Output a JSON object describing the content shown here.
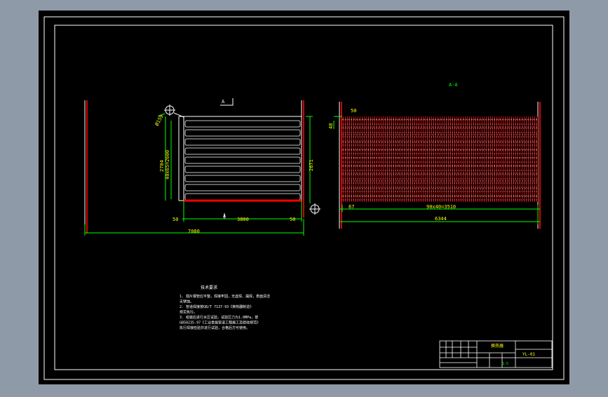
{
  "viewport": {
    "background": "#8e9aa8",
    "paper": "#000000"
  },
  "colors": {
    "white": "#ffffff",
    "yellow": "#ffff00",
    "green": "#00ff00",
    "red": "#ff0000",
    "dim": "#9a9a9a",
    "tube_red": "#c80000"
  },
  "left_view": {
    "section_marker": "A",
    "section_marker_bottom": "A",
    "dims": {
      "overall_width": "7080",
      "mid_width": "3800",
      "left_offset": "50",
      "right_offset": "50",
      "height_outer": "2704",
      "height_inner": "40x65=2600",
      "right_height": "2671",
      "pipe_dia": "Ø159"
    }
  },
  "right_view": {
    "section_title": "A-A",
    "dims": {
      "top_offset": "50",
      "left_offset": "48",
      "fin_pitch": "90x40=3510",
      "left_margin": "67",
      "overall_width": "6344"
    }
  },
  "notes": {
    "title": "技术要求",
    "lines": [
      "1. 翅片钢管应平整，焊接牢固，无虚焊、漏焊，表面清洁",
      "   无锈蚀。",
      "2. 管道焊接按GB/T 7137-93《换热器制造》",
      "   规定执行。",
      "3. 组装后进行水压试验，试验压力为1.0MPa，按",
      "   GB50235-97《工业金属管道工程施工及验收规范》",
      "   执行焊接检验并进行试验，合格后方可使用。"
    ]
  },
  "title_block": {
    "name": "换热器",
    "drawing_no": "YL-01",
    "scale": "1:5"
  }
}
